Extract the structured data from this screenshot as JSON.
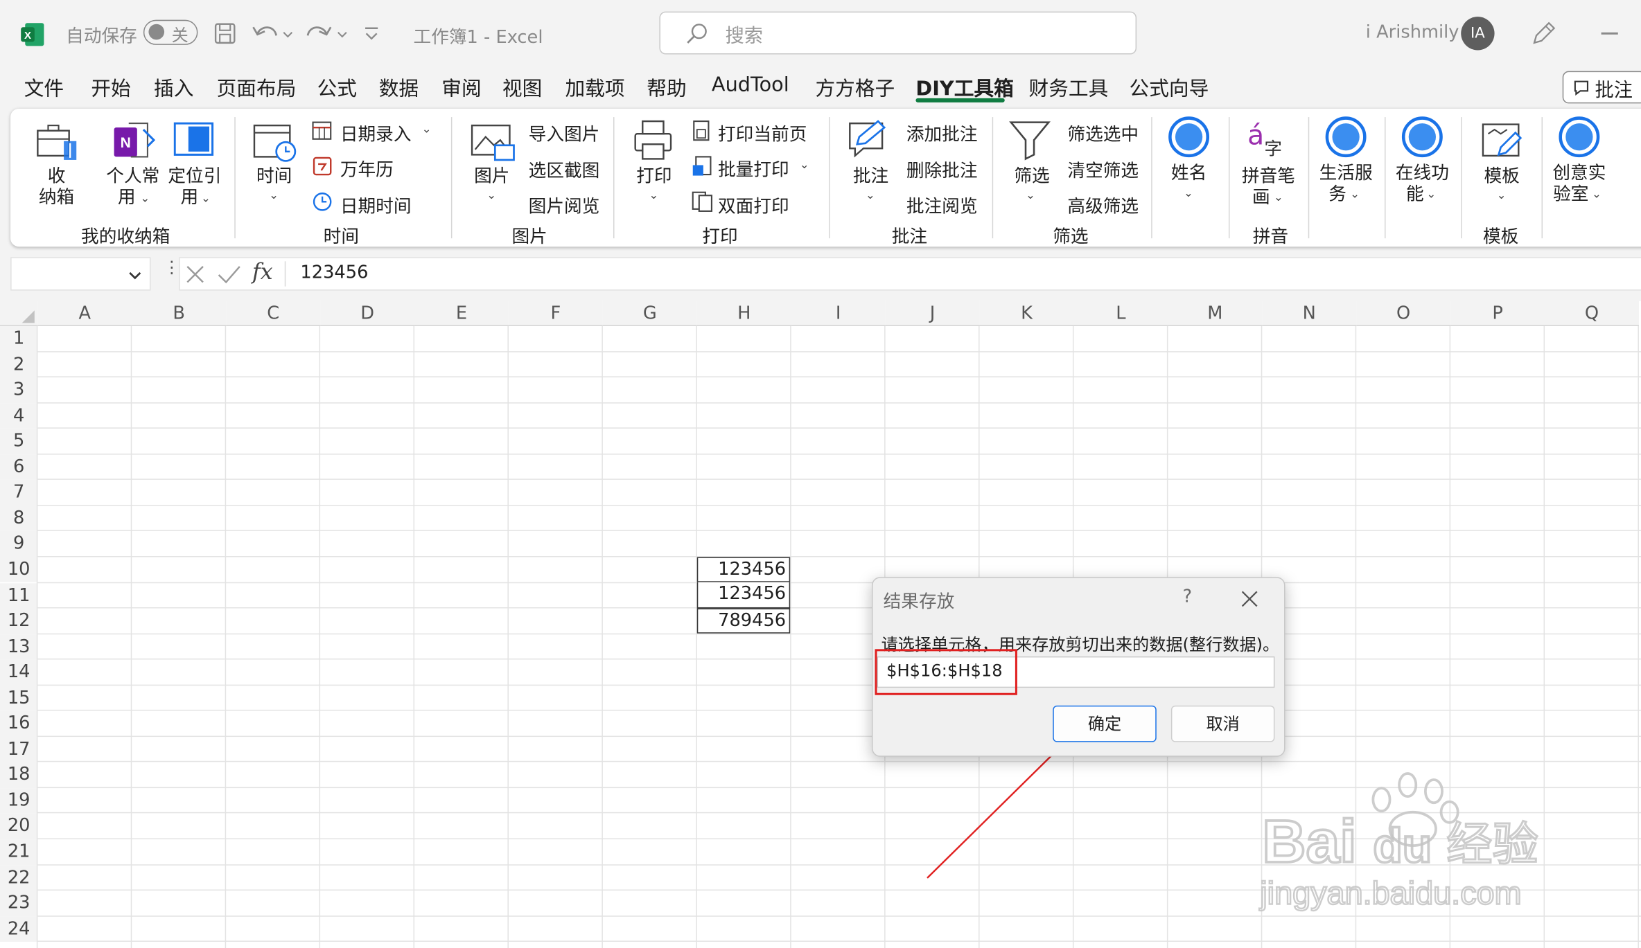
{
  "titlebar": {
    "autosave_label": "自动保存",
    "autosave_state": "关",
    "file_title": "工作簿1  -  Excel",
    "search_placeholder": "搜索",
    "user_name": "i Arishmily",
    "user_initials": "IA"
  },
  "tabs": [
    "文件",
    "开始",
    "插入",
    "页面布局",
    "公式",
    "数据",
    "审阅",
    "视图",
    "加载项",
    "帮助",
    "AudTool",
    "方方格子",
    "DIY工具箱",
    "财务工具",
    "公式向导"
  ],
  "active_tab": "DIY工具箱",
  "comment_button": "批注",
  "ribbon": {
    "groups": {
      "storage": "我的收纳箱",
      "time": "时间",
      "picture": "图片",
      "print": "打印",
      "comment": "批注",
      "filter": "筛选",
      "pinyin": "拼音",
      "template": "模板"
    },
    "storage": {
      "box_l1": "收",
      "box_l2": "纳箱",
      "personal_l1": "个人常",
      "personal_l2": "用",
      "locate_l1": "定位引",
      "locate_l2": "用"
    },
    "time": {
      "big": "时间",
      "date_entry": "日期录入",
      "calendar": "万年历",
      "datetime": "日期时间"
    },
    "picture": {
      "big": "图片",
      "import": "导入图片",
      "screenshot": "选区截图",
      "browse": "图片阅览"
    },
    "print": {
      "big": "打印",
      "current": "打印当前页",
      "batch": "批量打印",
      "duplex": "双面打印"
    },
    "comment": {
      "big": "批注",
      "add": "添加批注",
      "delete": "删除批注",
      "browse": "批注阅览"
    },
    "filter": {
      "big": "筛选",
      "selected": "筛选选中",
      "clear": "清空筛选",
      "advanced": "高级筛选"
    },
    "name": "姓名",
    "pinyin": {
      "l1": "拼音笔",
      "l2": "画"
    },
    "life": {
      "l1": "生活服",
      "l2": "务"
    },
    "online": {
      "l1": "在线功",
      "l2": "能"
    },
    "template": {
      "big": "模板"
    },
    "lab": {
      "l1": "创意实",
      "l2": "验室"
    }
  },
  "formula_bar": {
    "fx": "fx",
    "value": "123456"
  },
  "columns": [
    "A",
    "B",
    "C",
    "D",
    "E",
    "F",
    "G",
    "H",
    "I",
    "J",
    "K",
    "L",
    "M",
    "N",
    "O",
    "P",
    "Q"
  ],
  "rows": [
    "1",
    "2",
    "3",
    "4",
    "5",
    "6",
    "7",
    "8",
    "9",
    "10",
    "11",
    "12",
    "13",
    "14",
    "15",
    "16",
    "17",
    "18",
    "19",
    "20",
    "21",
    "22",
    "23",
    "24"
  ],
  "cells": {
    "H10": "123456",
    "H11": "123456",
    "H12": "789456"
  },
  "dialog": {
    "title": "结果存放",
    "help": "?",
    "prompt": "请选择单元格，用来存放剪切出来的数据(整行数据)。",
    "input_value": "$H$16:$H$18",
    "ok": "确定",
    "cancel": "取消"
  },
  "colors": {
    "excel_green": "#107c41",
    "annotation_red": "#e02020",
    "accent_blue": "#1a73e8"
  },
  "watermark": {
    "brand": "Baidu经验",
    "url": "jingyan.baidu.com"
  }
}
